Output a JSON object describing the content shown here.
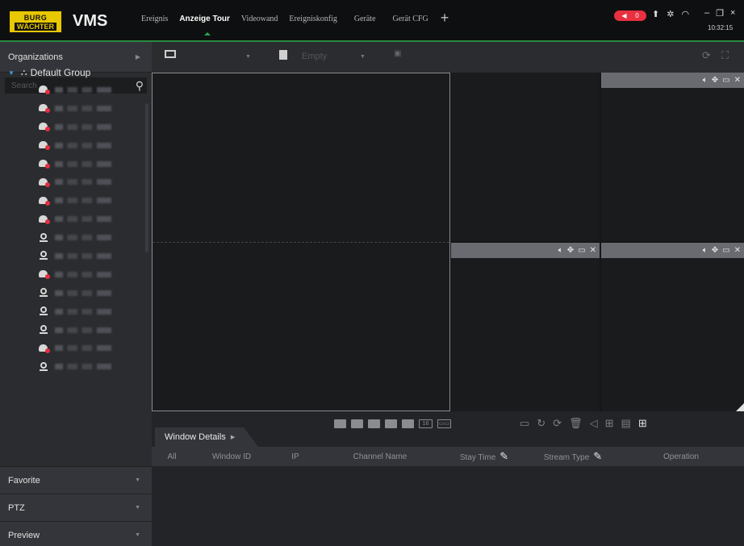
{
  "app": {
    "logo_line1": "BURG",
    "logo_line2": "WÄCHTER",
    "title": "VMS",
    "clock": "10:32:15",
    "alarm_count": "0"
  },
  "tabs": [
    {
      "label": "Ereignis",
      "active": false
    },
    {
      "label": "Anzeige Tour",
      "active": true
    },
    {
      "label": "Videowand",
      "active": false
    },
    {
      "label": "Ereigniskonfig",
      "active": false
    },
    {
      "label": "Geräte",
      "active": false
    },
    {
      "label": "Gerät CFG",
      "active": false
    }
  ],
  "sidebar": {
    "organizations_label": "Organizations",
    "search_placeholder": "Search",
    "root_group": "Default Group",
    "devices": [
      {
        "type": "dome"
      },
      {
        "type": "dome"
      },
      {
        "type": "dome"
      },
      {
        "type": "dome"
      },
      {
        "type": "dome"
      },
      {
        "type": "dome"
      },
      {
        "type": "dome"
      },
      {
        "type": "dome"
      },
      {
        "type": "camera"
      },
      {
        "type": "camera"
      },
      {
        "type": "dome"
      },
      {
        "type": "camera"
      },
      {
        "type": "camera"
      },
      {
        "type": "camera"
      },
      {
        "type": "dome"
      },
      {
        "type": "camera"
      }
    ],
    "sections": [
      {
        "label": "Favorite"
      },
      {
        "label": "PTZ"
      },
      {
        "label": "Preview"
      }
    ]
  },
  "toolbar": {
    "layout_icon": "1x1",
    "preset_label": "Empty"
  },
  "details": {
    "tab_label": "Window Details",
    "layout_buttons": [
      "1",
      "4",
      "6",
      "8",
      "9",
      "16",
      "custom"
    ],
    "layout_16_label": "16",
    "columns": [
      "All",
      "Window ID",
      "IP",
      "Channel Name",
      "Stay Time",
      "Stream Type",
      "Operation"
    ]
  },
  "colors": {
    "accent_green": "#2aa84e",
    "alarm_red": "#e83040",
    "logo_yellow": "#e8c800"
  }
}
